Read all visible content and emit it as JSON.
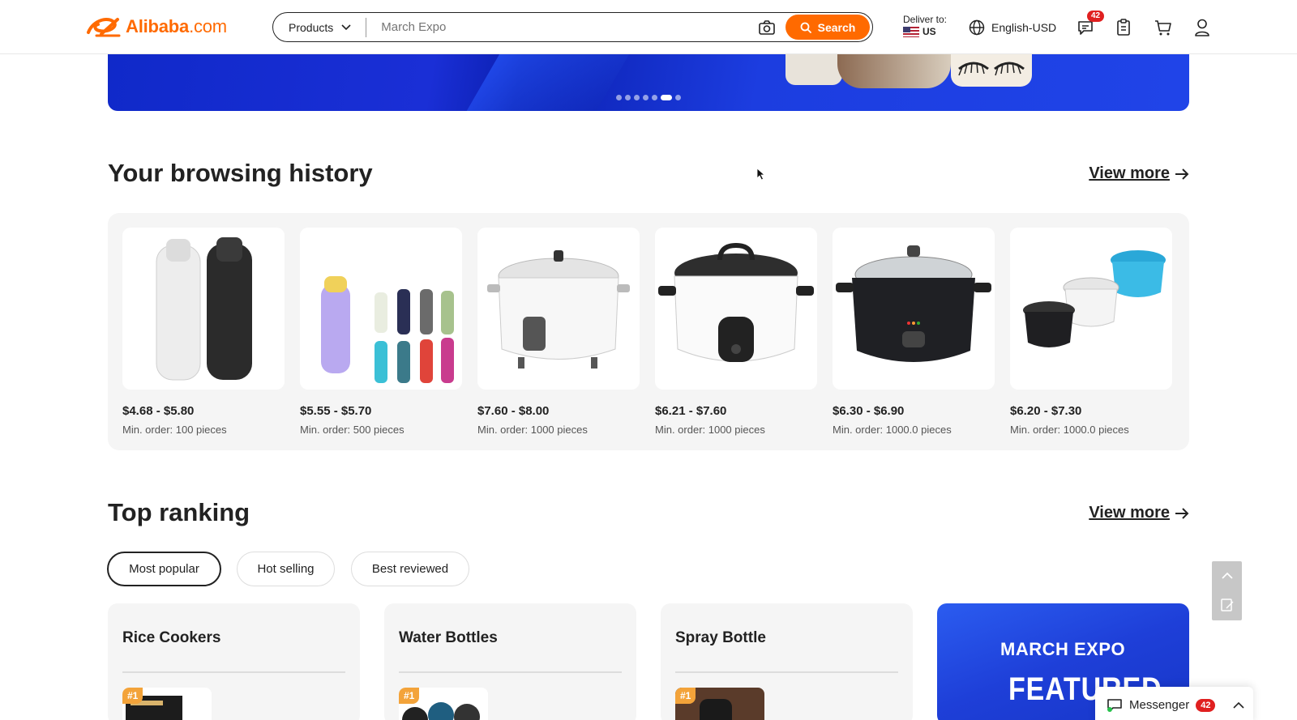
{
  "header": {
    "logo_name": "Alibaba",
    "logo_suffix": ".com",
    "products_label": "Products",
    "search_placeholder": "March Expo",
    "search_button": "Search",
    "deliver_label": "Deliver to:",
    "deliver_country": "US",
    "language": "English-USD",
    "messages_badge": "42"
  },
  "banner": {
    "dot_count": 7,
    "active_dot": 6
  },
  "browsing_history": {
    "title": "Your browsing history",
    "view_more": "View more",
    "items": [
      {
        "price": "$4.68 - $5.80",
        "moq": "Min. order: 100 pieces",
        "image": "water-bottles-white-black"
      },
      {
        "price": "$5.55 - $5.70",
        "moq": "Min. order: 500 pieces",
        "image": "water-bottles-colorful"
      },
      {
        "price": "$7.60 - $8.00",
        "moq": "Min. order: 1000 pieces",
        "image": "rice-cooker-white"
      },
      {
        "price": "$6.21 - $7.60",
        "moq": "Min. order: 1000 pieces",
        "image": "rice-cooker-white-black-lid"
      },
      {
        "price": "$6.30 - $6.90",
        "moq": "Min. order: 1000.0 pieces",
        "image": "rice-cooker-black"
      },
      {
        "price": "$6.20 - $7.30",
        "moq": "Min. order: 1000.0 pieces",
        "image": "rice-cookers-set"
      }
    ]
  },
  "top_ranking": {
    "title": "Top ranking",
    "view_more": "View more",
    "tabs": [
      {
        "label": "Most popular",
        "active": true
      },
      {
        "label": "Hot selling",
        "active": false
      },
      {
        "label": "Best reviewed",
        "active": false
      }
    ],
    "cards": [
      {
        "title": "Rice Cookers",
        "rank": "#1"
      },
      {
        "title": "Water Bottles",
        "rank": "#1"
      },
      {
        "title": "Spray Bottle",
        "rank": "#1"
      }
    ],
    "promo": {
      "title": "MARCH EXPO",
      "subtitle": "FEATURED"
    }
  },
  "messenger": {
    "label": "Messenger",
    "badge": "42"
  },
  "colors": {
    "accent": "#ff6a00",
    "badge": "#e02020",
    "banner_blue": "#1a2fd6"
  }
}
